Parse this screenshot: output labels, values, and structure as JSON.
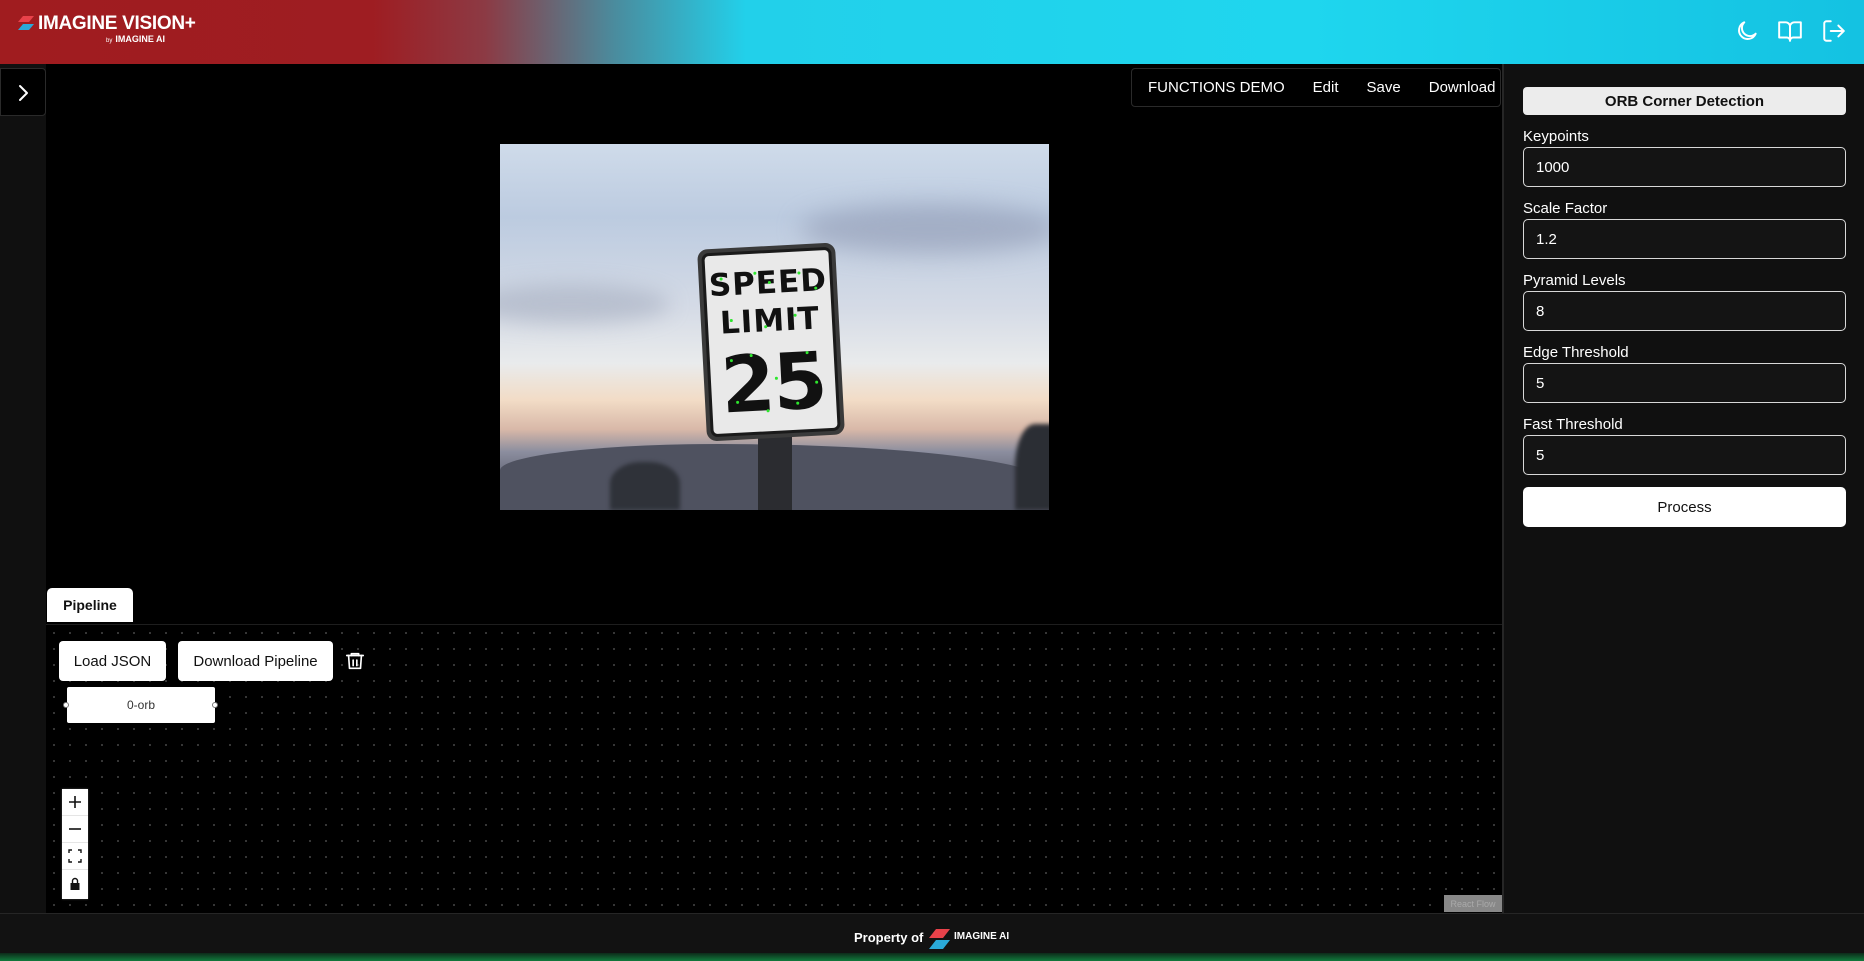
{
  "header": {
    "logo_title": "IMAGINE VISION+",
    "logo_by": "by",
    "logo_sub": "IMAGINE AI",
    "icons": [
      "moon-icon",
      "book-open-icon",
      "logout-icon"
    ]
  },
  "menubar": {
    "items": [
      "FUNCTIONS DEMO",
      "Edit",
      "Save",
      "Download"
    ]
  },
  "photo": {
    "sign_line1": "SPEED",
    "sign_line2": "LIMIT",
    "sign_line3": "25"
  },
  "pipeline": {
    "tab_label": "Pipeline",
    "load_json_label": "Load JSON",
    "download_pipeline_label": "Download Pipeline",
    "node_label": "0-orb",
    "attribution": "React Flow"
  },
  "panel": {
    "title": "ORB Corner Detection",
    "fields": [
      {
        "label": "Keypoints",
        "value": "1000"
      },
      {
        "label": "Scale Factor",
        "value": "1.2"
      },
      {
        "label": "Pyramid Levels",
        "value": "8"
      },
      {
        "label": "Edge Threshold",
        "value": "5"
      },
      {
        "label": "Fast Threshold",
        "value": "5"
      }
    ],
    "process_label": "Process"
  },
  "footer": {
    "property_text": "Property of",
    "logo_text": "IMAGINE AI"
  },
  "colors": {
    "brand_red": "#a01c1f",
    "brand_cyan": "#1fd6ee",
    "keypoint_green": "#2ee62e"
  }
}
